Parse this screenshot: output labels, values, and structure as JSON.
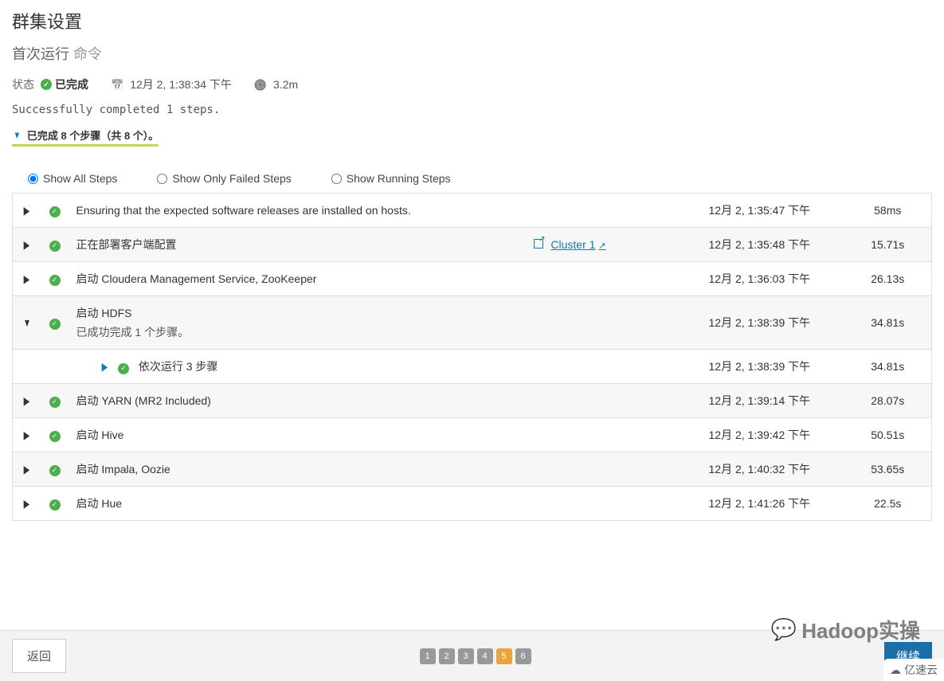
{
  "page": {
    "title": "群集设置",
    "subtitle_prefix": "首次运行",
    "subtitle_suffix": "命令"
  },
  "status": {
    "label": "状态",
    "value": "已完成",
    "timestamp": "12月 2, 1:38:34 下午",
    "duration": "3.2m"
  },
  "success_msg": "Successfully completed 1 steps.",
  "summary_text": "已完成 8 个步骤（共 8 个）。",
  "filters": {
    "all": "Show All Steps",
    "failed": "Show Only Failed Steps",
    "running": "Show Running Steps"
  },
  "steps": [
    {
      "name": "Ensuring that the expected software releases are installed on hosts.",
      "link": "",
      "time": "12月 2, 1:35:47 下午",
      "duration": "58ms"
    },
    {
      "name": "正在部署客户端配置",
      "link": "Cluster 1",
      "time": "12月 2, 1:35:48 下午",
      "duration": "15.71s"
    },
    {
      "name": "启动 Cloudera Management Service, ZooKeeper",
      "link": "",
      "time": "12月 2, 1:36:03 下午",
      "duration": "26.13s"
    },
    {
      "name": "启动 HDFS",
      "sub_msg": "已成功完成 1 个步骤。",
      "link": "",
      "time": "12月 2, 1:38:39 下午",
      "duration": "34.81s",
      "expanded": true,
      "child": {
        "name": "依次运行 3 步骤",
        "time": "12月 2, 1:38:39 下午",
        "duration": "34.81s"
      }
    },
    {
      "name": "启动 YARN (MR2 Included)",
      "link": "",
      "time": "12月 2, 1:39:14 下午",
      "duration": "28.07s"
    },
    {
      "name": "启动 Hive",
      "link": "",
      "time": "12月 2, 1:39:42 下午",
      "duration": "50.51s"
    },
    {
      "name": "启动 Impala, Oozie",
      "link": "",
      "time": "12月 2, 1:40:32 下午",
      "duration": "53.65s"
    },
    {
      "name": "启动 Hue",
      "link": "",
      "time": "12月 2, 1:41:26 下午",
      "duration": "22.5s"
    }
  ],
  "bottom": {
    "back": "返回",
    "continue": "继续",
    "pages": [
      "1",
      "2",
      "3",
      "4",
      "5",
      "6"
    ],
    "active_page": "5"
  },
  "watermark1": "Hadoop实操",
  "watermark2": "亿速云"
}
